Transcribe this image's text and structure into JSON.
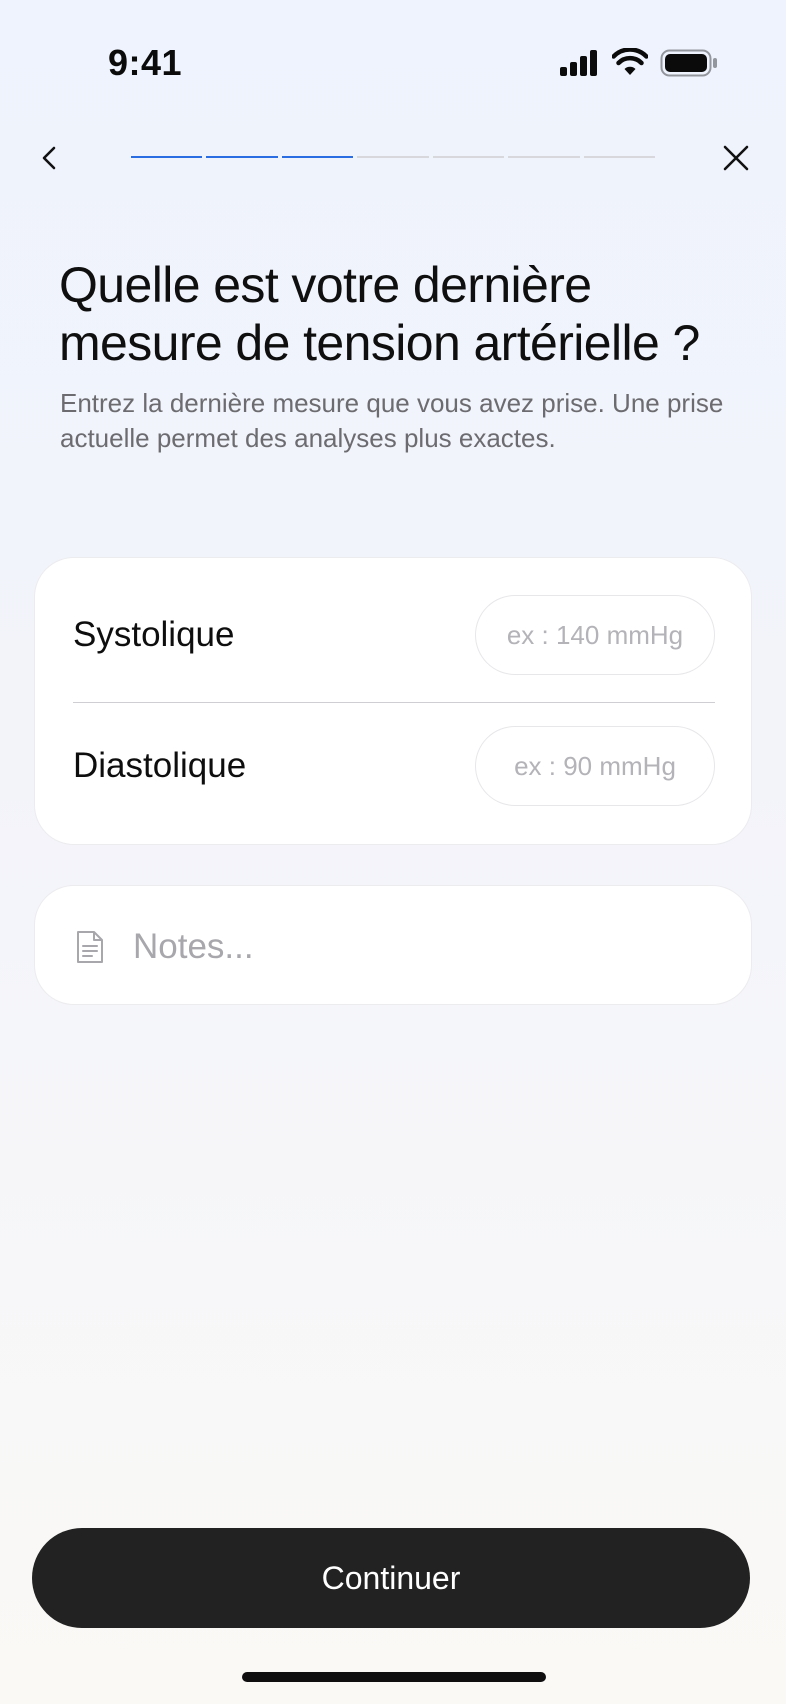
{
  "status_bar": {
    "time": "9:41",
    "icons": [
      "signal-icon",
      "wifi-icon",
      "battery-icon"
    ]
  },
  "nav": {
    "back_icon": "chevron-left-icon",
    "close_icon": "close-icon",
    "progress": {
      "total_steps": 7,
      "completed_steps": 3
    }
  },
  "question": {
    "title": "Quelle est votre dernière mesure de tension artérielle ?",
    "subtitle": "Entrez la dernière mesure que vous avez prise. Une prise actuelle permet des analyses plus exactes."
  },
  "form": {
    "systolic": {
      "label": "Systolique",
      "placeholder": "ex : 140 mmHg",
      "value": ""
    },
    "diastolic": {
      "label": "Diastolique",
      "placeholder": "ex : 90 mmHg",
      "value": ""
    }
  },
  "notes": {
    "icon": "document-icon",
    "placeholder": "Notes...",
    "value": ""
  },
  "footer": {
    "continue_label": "Continuer"
  },
  "colors": {
    "progress_active": "#2a6de2",
    "progress_inactive": "#d8d8dc",
    "button_bg": "#222222",
    "button_text": "#ffffff"
  }
}
